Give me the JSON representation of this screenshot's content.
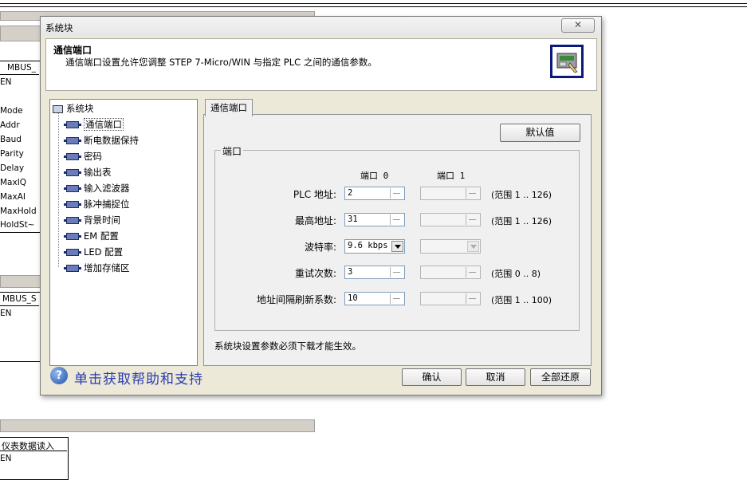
{
  "background": {
    "block1": {
      "title": "MBUS_",
      "en": "EN",
      "pins": [
        "Mode",
        "Addr",
        "Baud",
        "Parity",
        "Delay",
        "MaxIQ",
        "MaxAI",
        "MaxHold",
        "HoldSt~"
      ]
    },
    "block2": {
      "title": "MBUS_S",
      "en": "EN"
    },
    "block3": {
      "title": "仪表数据读入",
      "en": "EN"
    }
  },
  "dialog": {
    "title": "系统块",
    "close_glyph": "✕",
    "header_title": "通信端口",
    "header_desc": "通信端口设置允许您调整 STEP 7-Micro/WIN 与指定 PLC 之间的通信参数。",
    "tree": {
      "root": "系统块",
      "items": [
        "通信端口",
        "断电数据保持",
        "密码",
        "输出表",
        "输入滤波器",
        "脉冲捕捉位",
        "背景时间",
        "EM 配置",
        "LED 配置",
        "增加存储区"
      ]
    },
    "tab": "通信端口",
    "default_button": "默认值",
    "group_label": "端口",
    "col_port0": "端口 0",
    "col_port1": "端口 1",
    "rows": [
      {
        "label": "PLC 地址:",
        "port0": "2",
        "range": "(范围 1 .. 126)"
      },
      {
        "label": "最高地址:",
        "port0": "31",
        "range": "(范围 1 .. 126)"
      },
      {
        "label": "波特率:",
        "port0": "9.6 kbps",
        "range": ""
      },
      {
        "label": "重试次数:",
        "port0": "3",
        "range": "(范围 0 .. 8)"
      },
      {
        "label": "地址间隔刷新系数:",
        "port0": "10",
        "range": "(范围 1 .. 100)"
      }
    ],
    "note": "系统块设置参数必须下载才能生效。",
    "help_text": "单击获取帮助和支持",
    "buttons": {
      "ok": "确认",
      "cancel": "取消",
      "restore_all": "全部还原"
    }
  }
}
